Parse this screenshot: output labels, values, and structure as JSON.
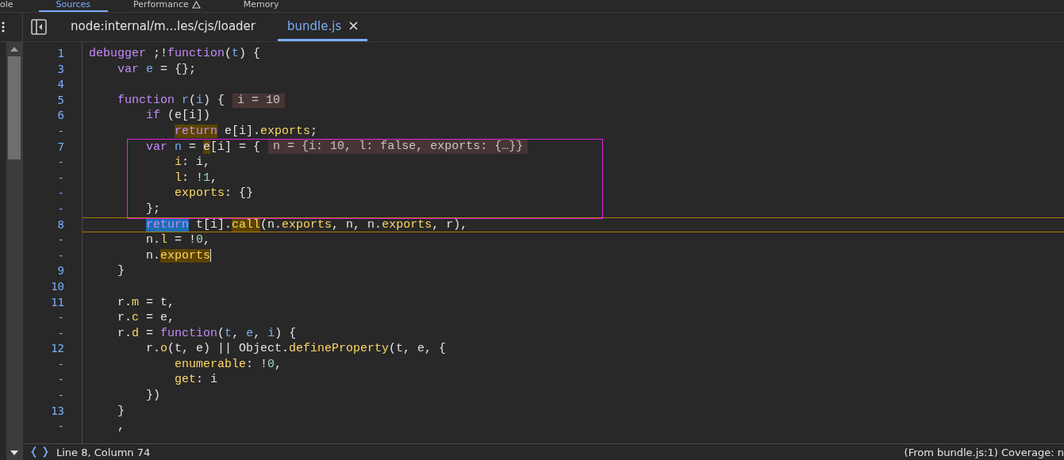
{
  "panel_tabs": [
    {
      "label": "ole",
      "selected": false
    },
    {
      "label": "Sources",
      "selected": true
    },
    {
      "label": "Performance",
      "selected": false,
      "warning": true
    },
    {
      "label": "Memory",
      "selected": false
    }
  ],
  "file_tabs": [
    {
      "label": "node:internal/m...les/cjs/loader",
      "selected": false,
      "closable": false
    },
    {
      "label": "bundle.js",
      "selected": true,
      "closable": true
    }
  ],
  "lines": [
    {
      "number": "1",
      "tokens": [
        {
          "text": "debugger",
          "kind": "keyword"
        },
        {
          "text": " ;!",
          "kind": "plain"
        },
        {
          "text": "function",
          "kind": "keyword"
        },
        {
          "text": "(",
          "kind": "plain"
        },
        {
          "text": "t",
          "kind": "variable"
        },
        {
          "text": ") {",
          "kind": "plain"
        }
      ]
    },
    {
      "number": "3",
      "tokens": [
        {
          "text": "    var ",
          "kind": "keyword"
        },
        {
          "text": "e",
          "kind": "variable"
        },
        {
          "text": " = {};",
          "kind": "plain"
        }
      ]
    },
    {
      "number": "4"
    },
    {
      "number": "5",
      "tokens": [
        {
          "text": "    function ",
          "kind": "keyword"
        },
        {
          "text": "r",
          "kind": "variable"
        },
        {
          "text": "(",
          "kind": "plain"
        },
        {
          "text": "i",
          "kind": "variable"
        },
        {
          "text": ") {",
          "kind": "plain"
        }
      ],
      "inline_value": "i = 10"
    },
    {
      "number": "6",
      "tokens": [
        {
          "text": "        if",
          "kind": "keyword"
        },
        {
          "text": " (e[i])",
          "kind": "plain"
        }
      ]
    },
    {
      "number": "-",
      "tokens": [
        {
          "text": "            return",
          "kind": "keyword",
          "step_target": true
        },
        {
          "text": " e[i].",
          "kind": "plain"
        },
        {
          "text": "exports",
          "kind": "property"
        },
        {
          "text": ";",
          "kind": "plain"
        }
      ]
    },
    {
      "number": "7",
      "boxed": true,
      "tokens": [
        {
          "text": "        var ",
          "kind": "keyword"
        },
        {
          "text": "n",
          "kind": "variable"
        },
        {
          "text": " = ",
          "kind": "plain"
        },
        {
          "text": "e",
          "kind": "plain",
          "step_target": true
        },
        {
          "text": "[i] = {",
          "kind": "plain"
        }
      ],
      "inline_value": "n = {i: 10, l: false, exports: {…}}"
    },
    {
      "number": "-",
      "boxed": true,
      "tokens": [
        {
          "text": "            i",
          "kind": "property"
        },
        {
          "text": ": i,",
          "kind": "plain"
        }
      ]
    },
    {
      "number": "-",
      "boxed": true,
      "tokens": [
        {
          "text": "            l",
          "kind": "property"
        },
        {
          "text": ": !",
          "kind": "plain"
        },
        {
          "text": "1",
          "kind": "number"
        },
        {
          "text": ",",
          "kind": "plain"
        }
      ]
    },
    {
      "number": "-",
      "boxed": true,
      "tokens": [
        {
          "text": "            exports",
          "kind": "property"
        },
        {
          "text": ": {}",
          "kind": "plain"
        }
      ]
    },
    {
      "number": "-",
      "boxed": true,
      "tokens": [
        {
          "text": "        };",
          "kind": "plain"
        }
      ]
    },
    {
      "number": "8",
      "current": true,
      "tokens": [
        {
          "text": "        return",
          "kind": "keyword",
          "paused_here": true
        },
        {
          "text": " t[i].",
          "kind": "plain"
        },
        {
          "text": "call",
          "kind": "property",
          "step_target": true
        },
        {
          "text": "(n.",
          "kind": "plain"
        },
        {
          "text": "exports",
          "kind": "property"
        },
        {
          "text": ", n, n.",
          "kind": "plain"
        },
        {
          "text": "exports",
          "kind": "property"
        },
        {
          "text": ", r),",
          "kind": "plain"
        }
      ]
    },
    {
      "number": "-",
      "tokens": [
        {
          "text": "        n.",
          "kind": "plain"
        },
        {
          "text": "l",
          "kind": "property"
        },
        {
          "text": " = !",
          "kind": "plain"
        },
        {
          "text": "0",
          "kind": "number"
        },
        {
          "text": ",",
          "kind": "plain"
        }
      ]
    },
    {
      "number": "-",
      "cursor": true,
      "tokens": [
        {
          "text": "        n.",
          "kind": "plain"
        },
        {
          "text": "exports",
          "kind": "property",
          "step_target": true
        }
      ]
    },
    {
      "number": "9",
      "tokens": [
        {
          "text": "    }",
          "kind": "plain"
        }
      ]
    },
    {
      "number": "10"
    },
    {
      "number": "11",
      "tokens": [
        {
          "text": "    r.",
          "kind": "plain"
        },
        {
          "text": "m",
          "kind": "property"
        },
        {
          "text": " = t,",
          "kind": "plain"
        }
      ]
    },
    {
      "number": "-",
      "tokens": [
        {
          "text": "    r.",
          "kind": "plain"
        },
        {
          "text": "c",
          "kind": "property"
        },
        {
          "text": " = e,",
          "kind": "plain"
        }
      ]
    },
    {
      "number": "-",
      "tokens": [
        {
          "text": "    r.",
          "kind": "plain"
        },
        {
          "text": "d",
          "kind": "property"
        },
        {
          "text": " = ",
          "kind": "plain"
        },
        {
          "text": "function",
          "kind": "keyword"
        },
        {
          "text": "(",
          "kind": "plain"
        },
        {
          "text": "t",
          "kind": "variable"
        },
        {
          "text": ", ",
          "kind": "plain"
        },
        {
          "text": "e",
          "kind": "variable"
        },
        {
          "text": ", ",
          "kind": "plain"
        },
        {
          "text": "i",
          "kind": "variable"
        },
        {
          "text": ") {",
          "kind": "plain"
        }
      ]
    },
    {
      "number": "12",
      "tokens": [
        {
          "text": "        r.",
          "kind": "plain"
        },
        {
          "text": "o",
          "kind": "property"
        },
        {
          "text": "(t, e) || Object.",
          "kind": "plain"
        },
        {
          "text": "defineProperty",
          "kind": "property"
        },
        {
          "text": "(t, e, {",
          "kind": "plain"
        }
      ]
    },
    {
      "number": "-",
      "tokens": [
        {
          "text": "            enumerable",
          "kind": "property"
        },
        {
          "text": ": !",
          "kind": "plain"
        },
        {
          "text": "0",
          "kind": "number"
        },
        {
          "text": ",",
          "kind": "plain"
        }
      ]
    },
    {
      "number": "-",
      "tokens": [
        {
          "text": "            get",
          "kind": "property"
        },
        {
          "text": ": i",
          "kind": "plain"
        }
      ]
    },
    {
      "number": "-",
      "tokens": [
        {
          "text": "        })",
          "kind": "plain"
        }
      ]
    },
    {
      "number": "13",
      "tokens": [
        {
          "text": "    }",
          "kind": "plain"
        }
      ]
    },
    {
      "number": "-",
      "tokens": [
        {
          "text": "    ,",
          "kind": "plain"
        }
      ]
    }
  ],
  "status_bar": {
    "position": "Line 8, Column 74",
    "coverage": "(From bundle.js:1) Coverage: n"
  }
}
